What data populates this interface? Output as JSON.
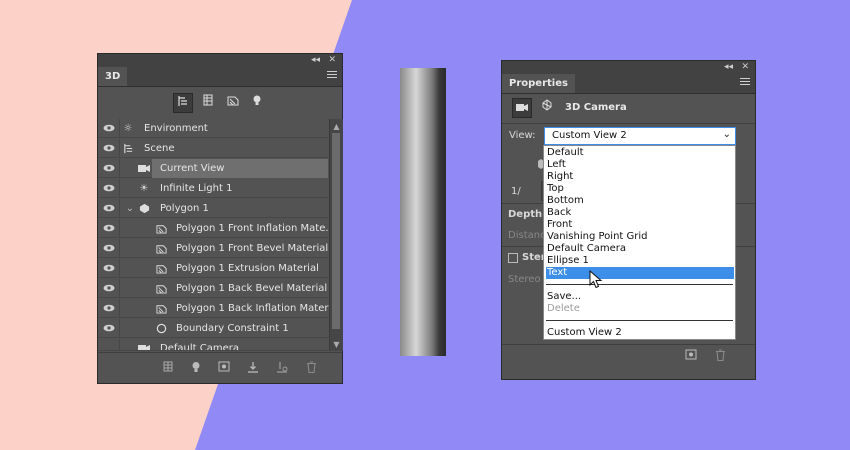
{
  "colors": {
    "bg_left": "#fcd2c8",
    "bg_right": "#9189f5",
    "panel": "#535353",
    "highlight": "#3d8ee8"
  },
  "panel3d": {
    "tab": "3D",
    "collapse_icon": "◂◂",
    "close_icon": "✕",
    "layers": [
      {
        "label": "Environment",
        "icon": "environment-icon"
      },
      {
        "label": "Scene",
        "icon": "scene-icon"
      },
      {
        "label": "Current View",
        "icon": "camera-icon"
      },
      {
        "label": "Infinite Light 1",
        "icon": "light-icon"
      },
      {
        "label": "Polygon 1",
        "icon": "mesh-icon"
      },
      {
        "label": "Polygon 1 Front Inflation Mate...",
        "icon": "material-icon"
      },
      {
        "label": "Polygon 1 Front Bevel Material",
        "icon": "material-icon"
      },
      {
        "label": "Polygon 1 Extrusion Material",
        "icon": "material-icon"
      },
      {
        "label": "Polygon 1 Back Bevel Material",
        "icon": "material-icon"
      },
      {
        "label": "Polygon 1 Back Inflation Material",
        "icon": "material-icon"
      },
      {
        "label": "Boundary Constraint 1",
        "icon": "constraint-icon"
      },
      {
        "label": "Default Camera",
        "icon": "camera-icon"
      }
    ]
  },
  "properties": {
    "tab": "Properties",
    "title": "3D Camera",
    "view_label": "View:",
    "view_value": "Custom View 2",
    "partial_fov": "1/",
    "partial_depth": "Depth C",
    "partial_distance": "Distance",
    "partial_stereo": "Stere",
    "partial_stereo_view": "Stereo V",
    "dropdown": {
      "options": [
        "Default",
        "Left",
        "Right",
        "Top",
        "Bottom",
        "Back",
        "Front",
        "Vanishing Point Grid",
        "Default Camera",
        "Ellipse 1",
        "Text"
      ],
      "highlighted": "Text",
      "save": "Save...",
      "delete": "Delete",
      "custom": "Custom View 2"
    }
  }
}
